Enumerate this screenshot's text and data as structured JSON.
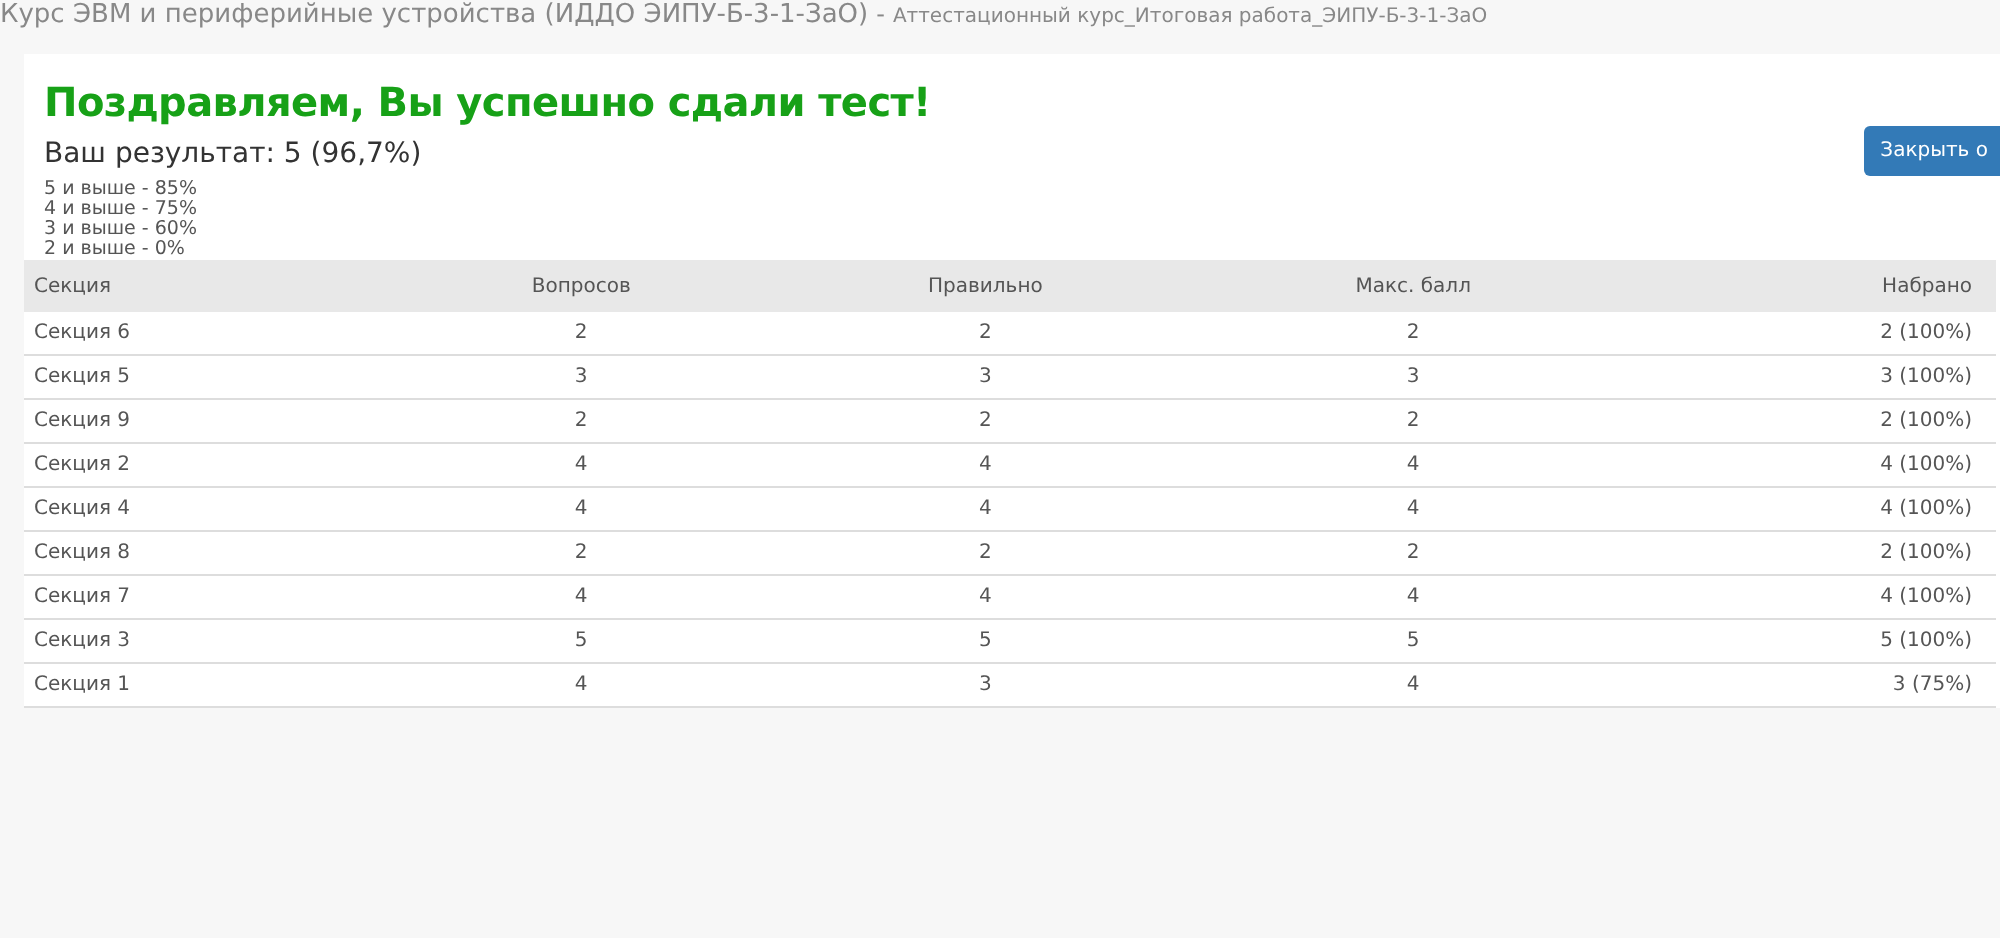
{
  "breadcrumb": {
    "course": "Курс ЭВМ и периферийные устройства (ИДДО ЭИПУ-Б-3-1-ЗаО)",
    "separator": "-",
    "test": "Аттестационный курс_Итоговая работа_ЭИПУ-Б-3-1-ЗаО"
  },
  "result": {
    "title": "Поздравляем, Вы успешно сдали тест!",
    "score": "Ваш результат: 5 (96,7%)",
    "grades": [
      "5 и выше - 85%",
      "4 и выше - 75%",
      "3 и выше - 60%",
      "2 и выше - 0%"
    ],
    "close_button": "Закрыть о"
  },
  "table": {
    "columns": [
      "Секция",
      "Вопросов",
      "Правильно",
      "Макс. балл",
      "Набрано"
    ],
    "rows": [
      [
        "Секция 6",
        "2",
        "2",
        "2",
        "2 (100%)"
      ],
      [
        "Секция 5",
        "3",
        "3",
        "3",
        "3 (100%)"
      ],
      [
        "Секция 9",
        "2",
        "2",
        "2",
        "2 (100%)"
      ],
      [
        "Секция 2",
        "4",
        "4",
        "4",
        "4 (100%)"
      ],
      [
        "Секция 4",
        "4",
        "4",
        "4",
        "4 (100%)"
      ],
      [
        "Секция 8",
        "2",
        "2",
        "2",
        "2 (100%)"
      ],
      [
        "Секция 7",
        "4",
        "4",
        "4",
        "4 (100%)"
      ],
      [
        "Секция 3",
        "5",
        "5",
        "5",
        "5 (100%)"
      ],
      [
        "Секция 1",
        "4",
        "3",
        "4",
        "3 (75%)"
      ]
    ]
  }
}
